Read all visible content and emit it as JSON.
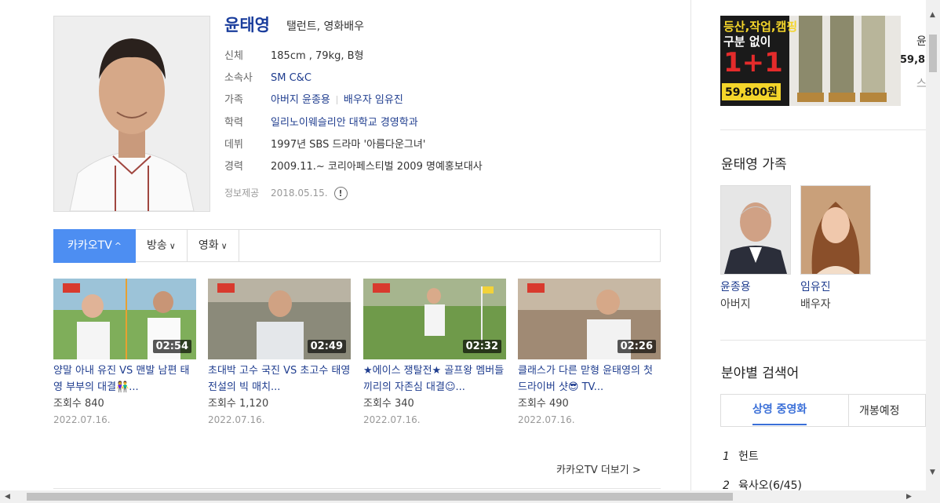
{
  "profile": {
    "name": "윤태영",
    "job": "탤런트, 영화배우",
    "rows": [
      {
        "key": "신체",
        "value": "185cm , 79kg, B형"
      },
      {
        "key": "소속사",
        "value": "SM C&C"
      },
      {
        "key": "가족",
        "value": "아버지 윤종용",
        "value2": "배우자 임유진"
      },
      {
        "key": "학력",
        "value": "일리노이웨슬리안 대학교 경영학과"
      },
      {
        "key": "데뷔",
        "value": "1997년 SBS 드라마 '아름다운그녀'"
      },
      {
        "key": "경력",
        "value": "2009.11.~ 코리아페스티벌 2009 명예홍보대사"
      }
    ],
    "meta": {
      "key": "정보제공",
      "value": "2018.05.15.",
      "icon": "!"
    }
  },
  "tabs": [
    {
      "label": "카카오TV",
      "chevron": "^"
    },
    {
      "label": "방송",
      "chevron": "∨"
    },
    {
      "label": "영화",
      "chevron": "∨"
    }
  ],
  "videos": [
    {
      "duration": "02:54",
      "title": "양말 아내 유진 VS 맨발 남편 태영 부부의 대결👫...",
      "views": "조회수 840",
      "date": "2022.07.16."
    },
    {
      "duration": "02:49",
      "title": "초대박 고수 국진 VS 초고수 태영 전설의 빅 매치...",
      "views": "조회수 1,120",
      "date": "2022.07.16."
    },
    {
      "duration": "02:32",
      "title": "★에이스 쟁탈전★ 골프왕 멤버들끼리의 자존심 대결☺...",
      "views": "조회수 340",
      "date": "2022.07.16."
    },
    {
      "duration": "02:26",
      "title": "클래스가 다른 맏형 윤태영의 첫 드라이버 샷😎 TV...",
      "views": "조회수 490",
      "date": "2022.07.16."
    }
  ],
  "more_label": "카카오TV 더보기 >",
  "ad": {
    "line1": "등산,작업,캠핑",
    "line2": "구분 없이",
    "promo": "1+1",
    "price": "59,800원",
    "edge1": "윤",
    "edge2": "59,8",
    "edge3": "스"
  },
  "family": {
    "title": "윤태영 가족",
    "members": [
      {
        "name": "윤종용",
        "relation": "아버지"
      },
      {
        "name": "임유진",
        "relation": "배우자"
      }
    ]
  },
  "category": {
    "title": "분야별 검색어",
    "tab_active": "상영 중영화",
    "tab_other": "개봉예정",
    "ranks": [
      {
        "num": "1",
        "label": "헌트"
      },
      {
        "num": "2",
        "label": "육사오(6/45)"
      }
    ]
  },
  "colors": {
    "accent": "#4d8ef2",
    "link": "#1f3d8f",
    "name": "#1a3d9c"
  }
}
